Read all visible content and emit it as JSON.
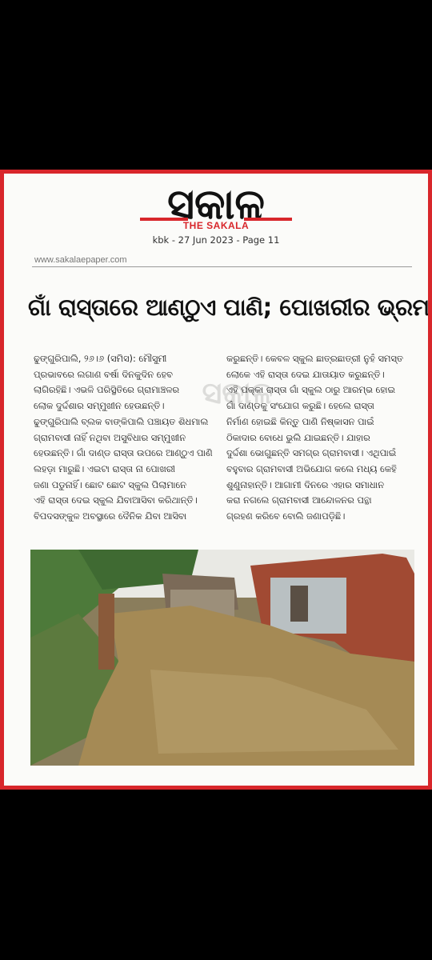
{
  "newspaper": {
    "logo_text": "ସକାଳ",
    "subtitle": "THE SAKALA",
    "dateline": "kbk - 27 Jun 2023 - Page 11",
    "url": "www.sakalaepaper.com"
  },
  "article": {
    "headline": "ଗାଁ ରାସ୍ତାରେ ଆଣ୍ଠୁଏ ପାଣି; ପୋଖରୀର ଭ୍ରମ",
    "left_column": [
      "ଢୁଙ୍ଗୁରିପାଲି, ୨୬।୬ (ସମିସ): ମୌସୁମୀ",
      "ପ୍ରଭାବରେ ଲଗାଣ ବର୍ଷା ଦିନକୁଦିନ ହେବ",
      "ଲାଗିରହିଛି। ଏଭଳି ପରିସ୍ଥିତିରେ ଗ୍ରାମାଞ୍ଚଳର",
      "ଲୋକ ଦୁର୍ଦ୍ଦଶାର ସମ୍ମୁଖୀନ ହେଉଛନ୍ତି।",
      "ଢୁଙ୍ଗୁରିପାଲି ବ୍ଲକ ବାଙ୍କିପାଲି ପଞ୍ଚାୟତ ଶିଧମାଲ",
      "ଗ୍ରାମବାସୀ ନାହିଁ ନଥିବା ଅସୁବିଧାର ସମ୍ମୁଖୀନ",
      "ହେଉଛନ୍ତି। ଗାଁ ଦାଣ୍ଡ ରାସ୍ତା ଉପରେ ଆଣ୍ଠୁଏ ପାଣି",
      "ଲହଡ଼ା ମାରୁଛି। ଏଇଟା ରାସ୍ତା ନା ପୋଖରୀ",
      "ଜଣା ପଡୁନାହିଁ। ଛୋଟ ଛୋଟ ସ୍କୁଲ ପିଲାମାନେ",
      "ଏହି ରାସ୍ତା ଦେଇ ସ୍କୁଲ ଯିବାଆସିବା କରିଥାନ୍ତି।",
      "ବିପଦସଙ୍କୁଳ ଅବସ୍ଥାରେ ଦୈନିକ ଯିବା ଆସିବା"
    ],
    "right_column": [
      "କରୁଛନ୍ତି। କେବଳ ସ୍କୁଲ ଛାତ୍ରଛାତ୍ରୀ ନୁହଁ ସମସ୍ତ",
      "ଲୋକେ ଏହି ରାସ୍ତା ଦେଇ ଯାତାୟାତ କରୁଛନ୍ତି।",
      "ଏହି ପକ୍କା ରାସ୍ତା ଗାଁ ସ୍କୁଲ ଠାରୁ ଆରମ୍ଭ ହୋଇ",
      "ଗାଁ ଦାଣ୍ଡକୁ ସଂଯୋଗ କରୁଛି। ହେଲେ ରାସ୍ତା",
      "ନିର୍ମାଣ ହୋଇଛି କିନ୍ତୁ ପାଣି ନିଷ୍କାସନ ପାଇଁ",
      "ଠିକାଦାର ବୋଧେ ଭୁଲି ଯାଇଛନ୍ତି। ଯାହାର",
      "ଦୁର୍ଦ୍ଦଶା ଭୋଗୁଛନ୍ତି ସମଗ୍ର ଗ୍ରାମବାସୀ। ଏଥିପାଇଁ",
      "ବହୁବାର ଗ୍ରାମବାସୀ ଅଭିଯୋଗ କଲେ ମଧ୍ୟ କେହି",
      "ଶୁଣୁନାହାନ୍ତି। ଆଗାମୀ ଦିନରେ ଏହାର ସମାଧାନ",
      "କରା ନଗଲେ ଗ୍ରାମବାସୀ ଆନ୍ଦୋଳନର ପନ୍ଥା",
      "ଗ୍ରହଣ କରିବେ ବୋଲି ଜଣାପଡ଼ିଛି।"
    ]
  },
  "colors": {
    "brand_red": "#d8262b",
    "logo_black": "#111111"
  }
}
